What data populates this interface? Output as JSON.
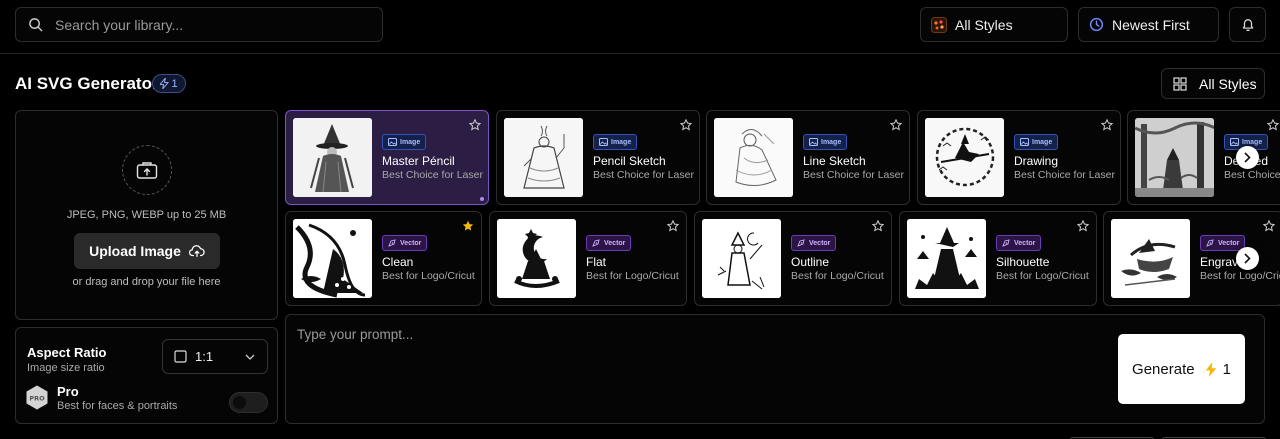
{
  "topbar": {
    "search_placeholder": "Search your library...",
    "styles_filter": "All Styles",
    "sort": "Newest First"
  },
  "header": {
    "title": "AI SVG Generator",
    "credits": "1",
    "all_styles": "All Styles"
  },
  "upload": {
    "formats": "JPEG, PNG, WEBP up to 25 MB",
    "button": "Upload Image",
    "drag_text": "or drag and drop your file here"
  },
  "settings": {
    "aspect_label": "Aspect Ratio",
    "aspect_sub": "Image size ratio",
    "ratio_value": "1:1",
    "pro_badge": "PRO",
    "pro_label": "Pro",
    "pro_sub": "Best for faces & portraits",
    "pro_enabled": false
  },
  "styles_row1": [
    {
      "tag": "Image",
      "name": "Master Péncil",
      "sub": "Best Choice for Laser",
      "selected": true,
      "starred": false
    },
    {
      "tag": "Image",
      "name": "Pencil Sketch",
      "sub": "Best Choice for Laser",
      "selected": false,
      "starred": false
    },
    {
      "tag": "Image",
      "name": "Line Sketch",
      "sub": "Best Choice for Laser",
      "selected": false,
      "starred": false
    },
    {
      "tag": "Image",
      "name": "Drawing",
      "sub": "Best Choice for Laser",
      "selected": false,
      "starred": false
    },
    {
      "tag": "Image",
      "name": "Detailed",
      "sub": "Best Choice for Laser",
      "selected": false,
      "starred": false
    }
  ],
  "styles_row2": [
    {
      "tag": "Vector",
      "name": "Clean",
      "sub": "Best for Logo/Cricut",
      "selected": false,
      "starred": true
    },
    {
      "tag": "Vector",
      "name": "Flat",
      "sub": "Best for Logo/Cricut",
      "selected": false,
      "starred": false
    },
    {
      "tag": "Vector",
      "name": "Outline",
      "sub": "Best for Logo/Cricut",
      "selected": false,
      "starred": false
    },
    {
      "tag": "Vector",
      "name": "Silhouette",
      "sub": "Best for Logo/Cricut",
      "selected": false,
      "starred": false
    },
    {
      "tag": "Vector",
      "name": "Engraving",
      "sub": "Best for Logo/Cricut",
      "selected": false,
      "starred": false
    }
  ],
  "prompt": {
    "placeholder": "Type your prompt...",
    "generate_label": "Generate",
    "generate_cost": "1"
  },
  "colors": {
    "accent_purple": "#7b55c9",
    "selected_bg": "#2b1d44",
    "star_gold": "#f2b90f",
    "bolt_yellow": "#f5b800"
  }
}
